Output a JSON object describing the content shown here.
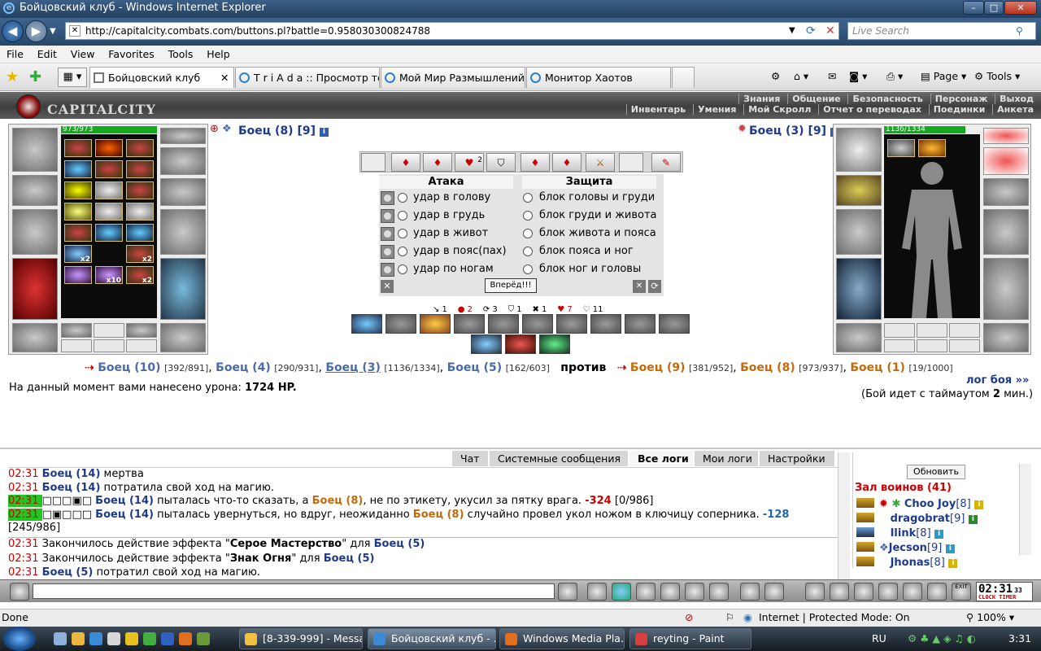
{
  "window": {
    "title": "Бойцовский клуб - Windows Internet Explorer"
  },
  "address": {
    "url": "http://capitalcity.combats.com/buttons.pl?battle=0.958030300824788",
    "search_placeholder": "Live Search"
  },
  "menu": [
    "File",
    "Edit",
    "View",
    "Favorites",
    "Tools",
    "Help"
  ],
  "tabs": [
    {
      "label": "Бойцовский клуб",
      "active": true
    },
    {
      "label": "T r i A d a :: Просмотр те...",
      "active": false
    },
    {
      "label": "Мой Мир Размышлений",
      "active": false
    },
    {
      "label": "Монитор Хаотов",
      "active": false
    }
  ],
  "toolbar": {
    "page": "Page",
    "tools": "Tools"
  },
  "game": {
    "logo": "CAPITALCITY",
    "nav_top": [
      "Знания",
      "Общение",
      "Безопасность",
      "Персонаж",
      "Выход"
    ],
    "nav_bottom": [
      "Инвентарь",
      "Умения",
      "Мой Скролл",
      "Отчет о переводах",
      "Поединки",
      "Анкета"
    ],
    "left_fighter": {
      "name": "Боец",
      "level": "(8)",
      "bracket": "[9]",
      "hp_text": "973/973",
      "hp_fraction": 1.0,
      "inv_counts": [
        "x2",
        "x2",
        "x10",
        "x2"
      ]
    },
    "right_fighter": {
      "name": "Боец",
      "level": "(3)",
      "bracket": "[9]",
      "hp_text": "1136/1334",
      "hp_fraction": 0.85
    },
    "strip_count": "2",
    "attack": {
      "title": "Атака",
      "options": [
        "удар в голову",
        "удар в грудь",
        "удар в живот",
        "удар в пояс(пах)",
        "удар по ногам"
      ]
    },
    "defense": {
      "title": "Защита",
      "options": [
        "блок головы и груди",
        "блок груди и живота",
        "блок живота и пояса",
        "блок пояса и ног",
        "блок ног и головы"
      ]
    },
    "forward_button": "Вперёд!!!",
    "stats": [
      "↘ 1",
      "● 2",
      "⟳ 3",
      "⛉ 1",
      "✖ 1",
      "♥ 7",
      "♡ 11"
    ],
    "vs": {
      "team1": [
        {
          "name": "Боец (10)",
          "hp": "[392/891]"
        },
        {
          "name": "Боец (4)",
          "hp": "[290/931]"
        },
        {
          "name": "Боец (3)",
          "hp": "[1136/1334]"
        },
        {
          "name": "Боец (5)",
          "hp": "[162/603]"
        }
      ],
      "versus": "против",
      "team2": [
        {
          "name": "Боец (9)",
          "hp": "[381/952]"
        },
        {
          "name": "Боец (8)",
          "hp": "[973/937]"
        },
        {
          "name": "Боец (1)",
          "hp": "[19/1000]"
        }
      ]
    },
    "damage_prefix": "На данный момент вами нанесено урона:",
    "damage_value": "1724 HP.",
    "log_link": "лог боя »»",
    "timeout_prefix": "(Бой идет с таймаутом",
    "timeout_value": "2",
    "timeout_suffix": "мин.)"
  },
  "chat": {
    "tabs": [
      "Чат",
      "Системные сообщения",
      "Все логи",
      "Мои логи",
      "Настройки"
    ],
    "selected_tab": "Все логи",
    "lines": [
      {
        "time": "02:31",
        "parts": [
          [
            "b",
            "Боец (14)"
          ],
          [
            "",
            " мертва"
          ]
        ]
      },
      {
        "time": "02:31",
        "parts": [
          [
            "b",
            "Боец (14)"
          ],
          [
            "",
            " потратила свой ход на магию."
          ]
        ]
      },
      {
        "time": "02:31",
        "hl": true,
        "parts": [
          [
            "",
            "□□□▣□ "
          ],
          [
            "b",
            "Боец (14)"
          ],
          [
            "",
            " пыталась что-то сказать, а "
          ],
          [
            "o",
            "Боец (8)"
          ],
          [
            "",
            ", не по этикету, укусил за пятку врага. "
          ],
          [
            "r",
            "-324"
          ],
          [
            "",
            " [0/986]"
          ]
        ]
      },
      {
        "time": "02:31",
        "hl": true,
        "parts": [
          [
            "",
            "□▣□□□ "
          ],
          [
            "b",
            "Боец (14)"
          ],
          [
            "",
            " пыталась увернуться, но вдруг, неожиданно "
          ],
          [
            "o",
            "Боец (8)"
          ],
          [
            "",
            " случайно провел укол ножом в ключицу соперника. "
          ],
          [
            "bl",
            "-128"
          ]
        ]
      },
      {
        "time": "",
        "parts": [
          [
            "",
            "[245/986]"
          ]
        ]
      },
      {
        "time": "02:31",
        "sep": true,
        "parts": [
          [
            "",
            "Закончилось действие эффекта \""
          ],
          [
            "s",
            "Серое Мастерство"
          ],
          [
            "",
            "\" для "
          ],
          [
            "b",
            "Боец (5)"
          ]
        ]
      },
      {
        "time": "02:31",
        "parts": [
          [
            "",
            "Закончилось действие эффекта \""
          ],
          [
            "s",
            "Знак Огня"
          ],
          [
            "",
            "\" для "
          ],
          [
            "b",
            "Боец (5)"
          ]
        ]
      },
      {
        "time": "02:31",
        "parts": [
          [
            "b",
            "Боец (5)"
          ],
          [
            "",
            " потратил свой ход на магию."
          ]
        ]
      }
    ]
  },
  "roster": {
    "refresh": "Обновить",
    "hall": "Зал воинов (41)",
    "players": [
      {
        "name": "Choo Joy",
        "level": "[8]"
      },
      {
        "name": "dragobrat",
        "level": "[9]"
      },
      {
        "name": "Ilink",
        "level": "[8]"
      },
      {
        "name": "Jecson",
        "level": "[9]"
      },
      {
        "name": "Jhonas",
        "level": "[8]"
      }
    ]
  },
  "chatbar": {
    "clock": "02:31",
    "clock_seconds": "33",
    "clock_label": "CLOCK TIMER",
    "exit": "EXIT"
  },
  "status": {
    "left": "Done",
    "zone": "Internet | Protected Mode: On",
    "zoom": "100%"
  },
  "taskbar": {
    "items": [
      {
        "label": "[8-339-999] - Messa...",
        "active": false
      },
      {
        "label": "Бойцовский клуб - ...",
        "active": true
      },
      {
        "label": "Windows Media Pla...",
        "active": false
      },
      {
        "label": "reyting - Paint",
        "active": false
      }
    ],
    "lang": "RU",
    "time": "3:31"
  }
}
